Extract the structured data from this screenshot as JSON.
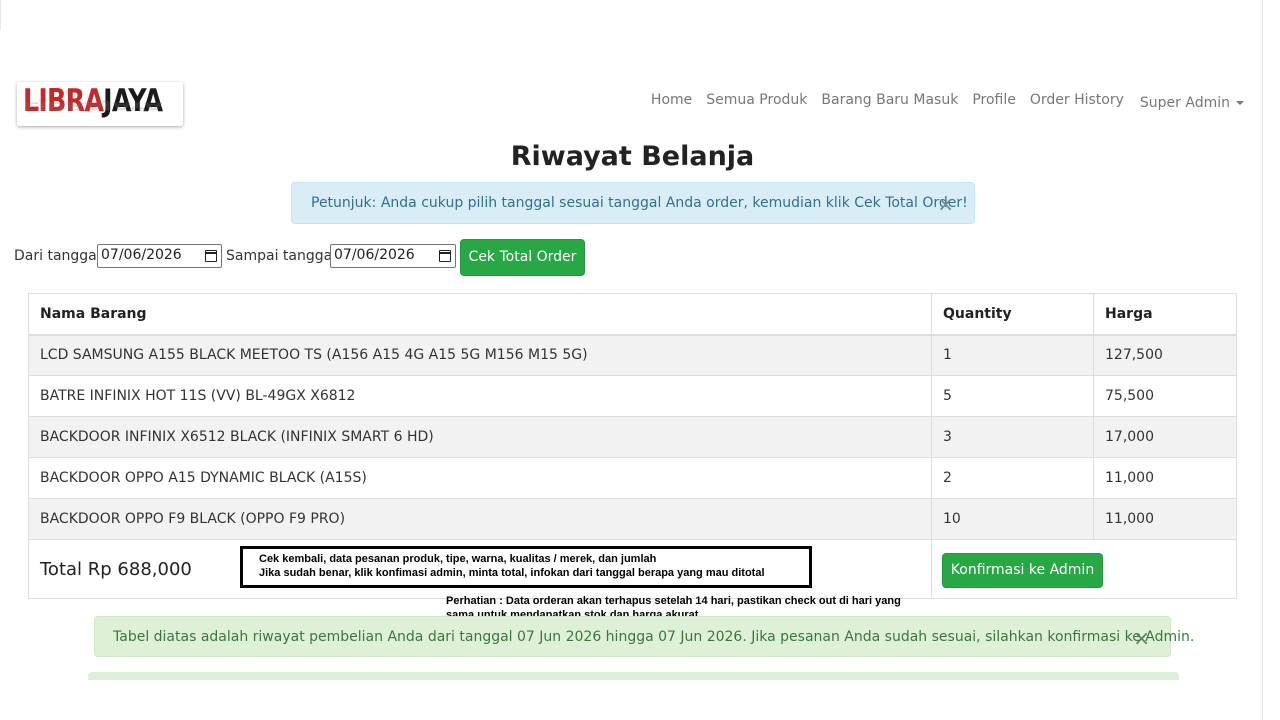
{
  "brand": {
    "logo_part1": "LIBRA",
    "logo_part2": "JAYA",
    "logo_primary_color": "#c62828"
  },
  "nav": {
    "links": [
      "Home",
      "Semua Produk",
      "Barang Baru Masuk",
      "Profile",
      "Order History"
    ],
    "user_menu": "Super Admin"
  },
  "page": {
    "title": "Riwayat Belanja"
  },
  "info_alert": {
    "message": "Petunjuk: Anda cukup pilih tanggal sesuai tanggal Anda order, kemudian klik Cek Total Order!",
    "close": "×"
  },
  "filter": {
    "from_label": "Dari tanggal",
    "from_value": "07/06/2026",
    "to_label": "Sampai tanggal",
    "to_value": "07/06/2026",
    "submit_label": "Cek Total Order"
  },
  "table": {
    "headers": [
      "Nama Barang",
      "Quantity",
      "Harga"
    ],
    "rows": [
      [
        "LCD SAMSUNG A155 BLACK MEETOO TS (A156 A15 4G A15 5G M156 M15 5G)",
        "1",
        "127,500"
      ],
      [
        "BATRE INFINIX HOT 11S (VV) BL-49GX X6812",
        "5",
        "75,500"
      ],
      [
        "BACKDOOR INFINIX X6512 BLACK (INFINIX SMART 6 HD)",
        "3",
        "17,000"
      ],
      [
        "BACKDOOR OPPO A15 DYNAMIC BLACK (A15S)",
        "2",
        "11,000"
      ],
      [
        "BACKDOOR OPPO F9 BLACK (OPPO F9 PRO)",
        "10",
        "11,000"
      ]
    ],
    "total_text": "Total Rp 688,000",
    "confirm_label": "Konfirmasi ke Admin"
  },
  "note": {
    "line1": "Cek kembali, data pesanan produk, tipe, warna, kualitas / merek, dan jumlah",
    "line2": "Jika sudah benar, klik konfimasi admin, minta total, infokan dari tanggal berapa yang mau ditotal"
  },
  "attention": {
    "line1": "Perhatian : Data orderan akan terhapus setelah 14 hari, pastikan check out di hari yang",
    "line2": "sama untuk mendapatkan stok dan harga akurat"
  },
  "success_alert": {
    "message": "Tabel diatas adalah riwayat pembelian Anda dari tanggal 07 Jun 2026 hingga 07 Jun 2026. Jika pesanan Anda sudah sesuai, silahkan konfirmasi ke Admin.",
    "close": "×"
  },
  "colors": {
    "green_button": "#28a745",
    "info_bg": "#d9edf7",
    "success_bg": "#dff0d8"
  }
}
